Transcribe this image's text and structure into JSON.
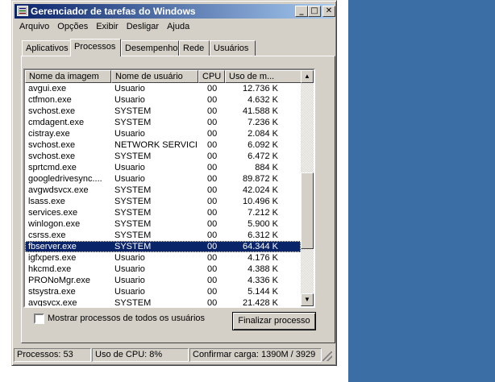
{
  "window": {
    "title": "Gerenciador de tarefas do Windows"
  },
  "title_buttons": {
    "minimize": "_",
    "maximize": "□",
    "close": "✕"
  },
  "menu": [
    "Arquivo",
    "Opções",
    "Exibir",
    "Desligar",
    "Ajuda"
  ],
  "tabs": [
    "Aplicativos",
    "Processos",
    "Desempenho",
    "Rede",
    "Usuários"
  ],
  "active_tab": "Processos",
  "columns": [
    "Nome da imagem",
    "Nome de usuário",
    "CPU",
    "Uso de m..."
  ],
  "processes": [
    {
      "name": "avgui.exe",
      "user": "Usuario",
      "cpu": "00",
      "mem": "12.736 K"
    },
    {
      "name": "ctfmon.exe",
      "user": "Usuario",
      "cpu": "00",
      "mem": "4.632 K"
    },
    {
      "name": "svchost.exe",
      "user": "SYSTEM",
      "cpu": "00",
      "mem": "41.588 K"
    },
    {
      "name": "cmdagent.exe",
      "user": "SYSTEM",
      "cpu": "00",
      "mem": "7.236 K"
    },
    {
      "name": "cistray.exe",
      "user": "Usuario",
      "cpu": "00",
      "mem": "2.084 K"
    },
    {
      "name": "svchost.exe",
      "user": "NETWORK SERVICE",
      "cpu": "00",
      "mem": "6.092 K"
    },
    {
      "name": "svchost.exe",
      "user": "SYSTEM",
      "cpu": "00",
      "mem": "6.472 K"
    },
    {
      "name": "sprtcmd.exe",
      "user": "Usuario",
      "cpu": "00",
      "mem": "884 K"
    },
    {
      "name": "googledrivesync....",
      "user": "Usuario",
      "cpu": "00",
      "mem": "89.872 K"
    },
    {
      "name": "avgwdsvcx.exe",
      "user": "SYSTEM",
      "cpu": "00",
      "mem": "42.024 K"
    },
    {
      "name": "lsass.exe",
      "user": "SYSTEM",
      "cpu": "00",
      "mem": "10.496 K"
    },
    {
      "name": "services.exe",
      "user": "SYSTEM",
      "cpu": "00",
      "mem": "7.212 K"
    },
    {
      "name": "winlogon.exe",
      "user": "SYSTEM",
      "cpu": "00",
      "mem": "5.900 K"
    },
    {
      "name": "csrss.exe",
      "user": "SYSTEM",
      "cpu": "00",
      "mem": "6.312 K"
    },
    {
      "name": "fbserver.exe",
      "user": "SYSTEM",
      "cpu": "00",
      "mem": "64.344 K",
      "selected": true
    },
    {
      "name": "igfxpers.exe",
      "user": "Usuario",
      "cpu": "00",
      "mem": "4.176 K"
    },
    {
      "name": "hkcmd.exe",
      "user": "Usuario",
      "cpu": "00",
      "mem": "4.388 K"
    },
    {
      "name": "PRONoMgr.exe",
      "user": "Usuario",
      "cpu": "00",
      "mem": "4.336 K"
    },
    {
      "name": "stsystra.exe",
      "user": "Usuario",
      "cpu": "00",
      "mem": "5.144 K"
    },
    {
      "name": "avgsvcx.exe",
      "user": "SYSTEM",
      "cpu": "00",
      "mem": "21.428 K"
    }
  ],
  "show_all_label": "Mostrar processos de todos os usuários",
  "end_process_label": "Finalizar processo",
  "status": {
    "processes": "Processos: 53",
    "cpu": "Uso de CPU: 8%",
    "commit": "Confirmar carga: 1390M / 3929"
  },
  "colors": {
    "title_start": "#0a246a",
    "title_end": "#a6caf0",
    "desktop": "#3a6ea5",
    "selection": "#0a246a"
  }
}
